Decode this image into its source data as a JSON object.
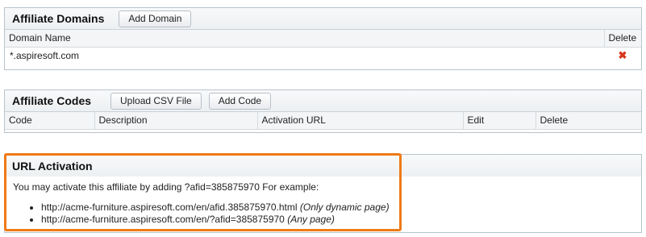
{
  "domains": {
    "title": "Affiliate Domains",
    "add_button": "Add Domain",
    "headers": {
      "name": "Domain Name",
      "delete": "Delete"
    },
    "rows": [
      {
        "name": "*.aspiresoft.com"
      }
    ]
  },
  "codes": {
    "title": "Affiliate Codes",
    "upload_button": "Upload CSV File",
    "add_button": "Add Code",
    "headers": {
      "code": "Code",
      "description": "Description",
      "activation_url": "Activation URL",
      "edit": "Edit",
      "delete": "Delete"
    }
  },
  "activation": {
    "title": "URL Activation",
    "intro": "You may activate this affiliate by adding ?afid=385875970 For example:",
    "examples": [
      {
        "url": "http://acme-furniture.aspiresoft.com/en/afid.385875970.html",
        "note": "(Only dynamic page)"
      },
      {
        "url": "http://acme-furniture.aspiresoft.com/en/?afid=385875970",
        "note": "(Any page)"
      }
    ]
  },
  "colors": {
    "highlight": "#f07a16",
    "delete_icon": "#d6361c"
  }
}
